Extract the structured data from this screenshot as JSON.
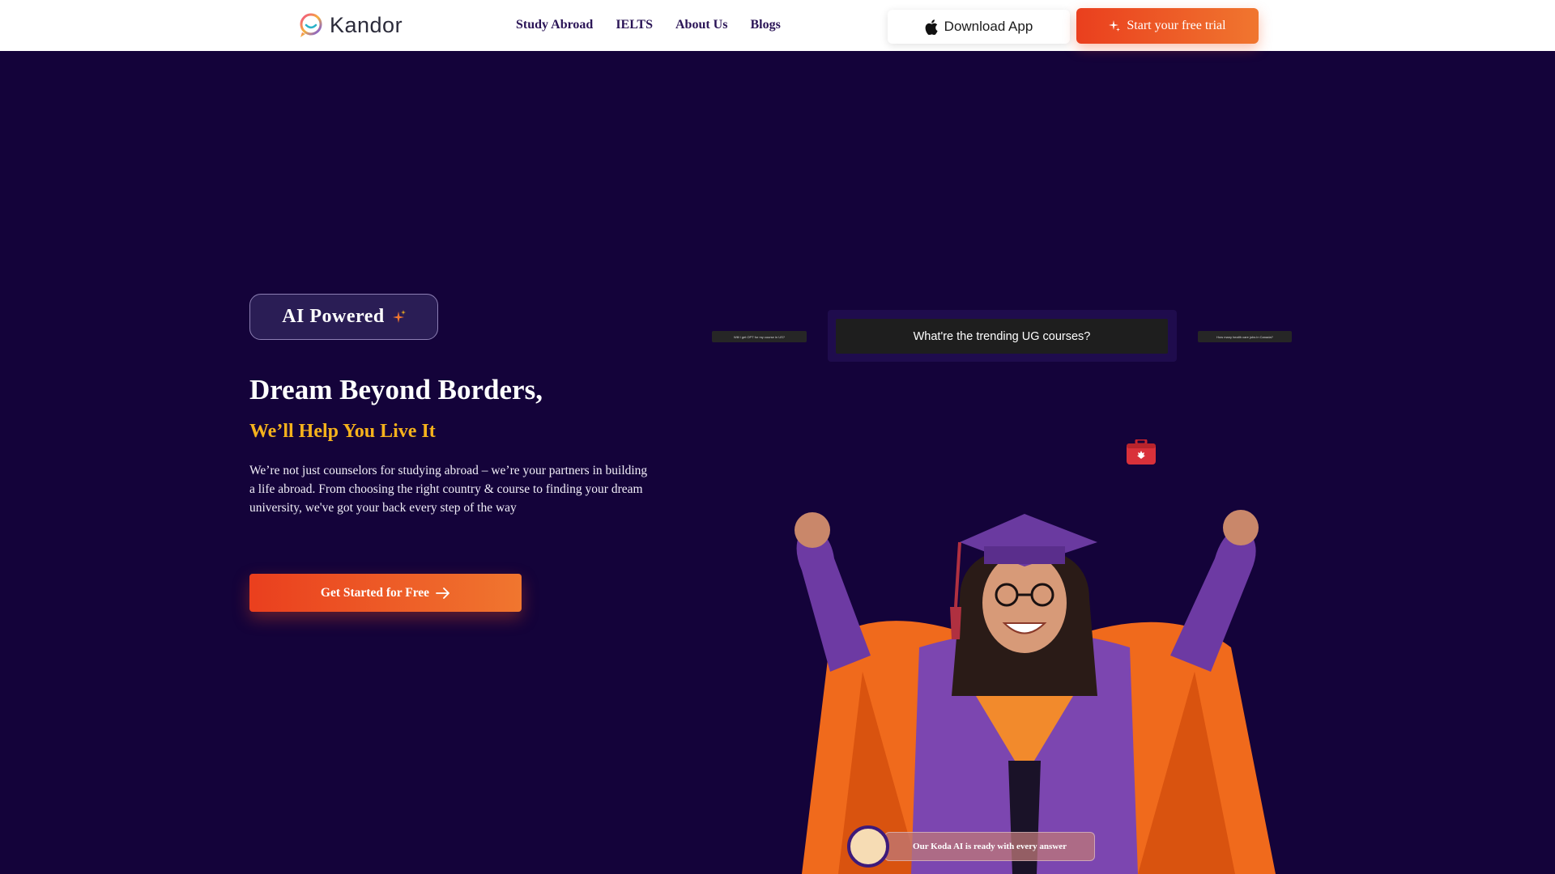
{
  "header": {
    "logo_text": "Kandor",
    "nav": [
      "Study Abroad",
      "IELTS",
      "About Us",
      "Blogs"
    ],
    "download_label": "Download App",
    "trial_label": "Start your free trial"
  },
  "hero": {
    "badge": "AI Powered",
    "title": "Dream Beyond Borders,",
    "subtitle": "We’ll Help You Live It",
    "description": "We’re not just counselors for studying abroad – we’re your partners in building a life abroad. From choosing the right country & course to finding your dream university, we've got your back every step of the way",
    "cta_label": "Get Started for Free"
  },
  "chat": {
    "main_question": "What're the trending UG courses?",
    "left_question": "Will I get OPT for my course in US?",
    "right_question": "How many health care jobs in Canada?",
    "koda_label": "Our Koda AI is ready with every answer"
  },
  "colors": {
    "background": "#14033a",
    "accent": "#ea3f1e",
    "highlight": "#f5b21c"
  },
  "icons": [
    "logo-mark",
    "apple-icon",
    "sparkle-icon",
    "arrow-right-icon",
    "suitcase-icon"
  ]
}
